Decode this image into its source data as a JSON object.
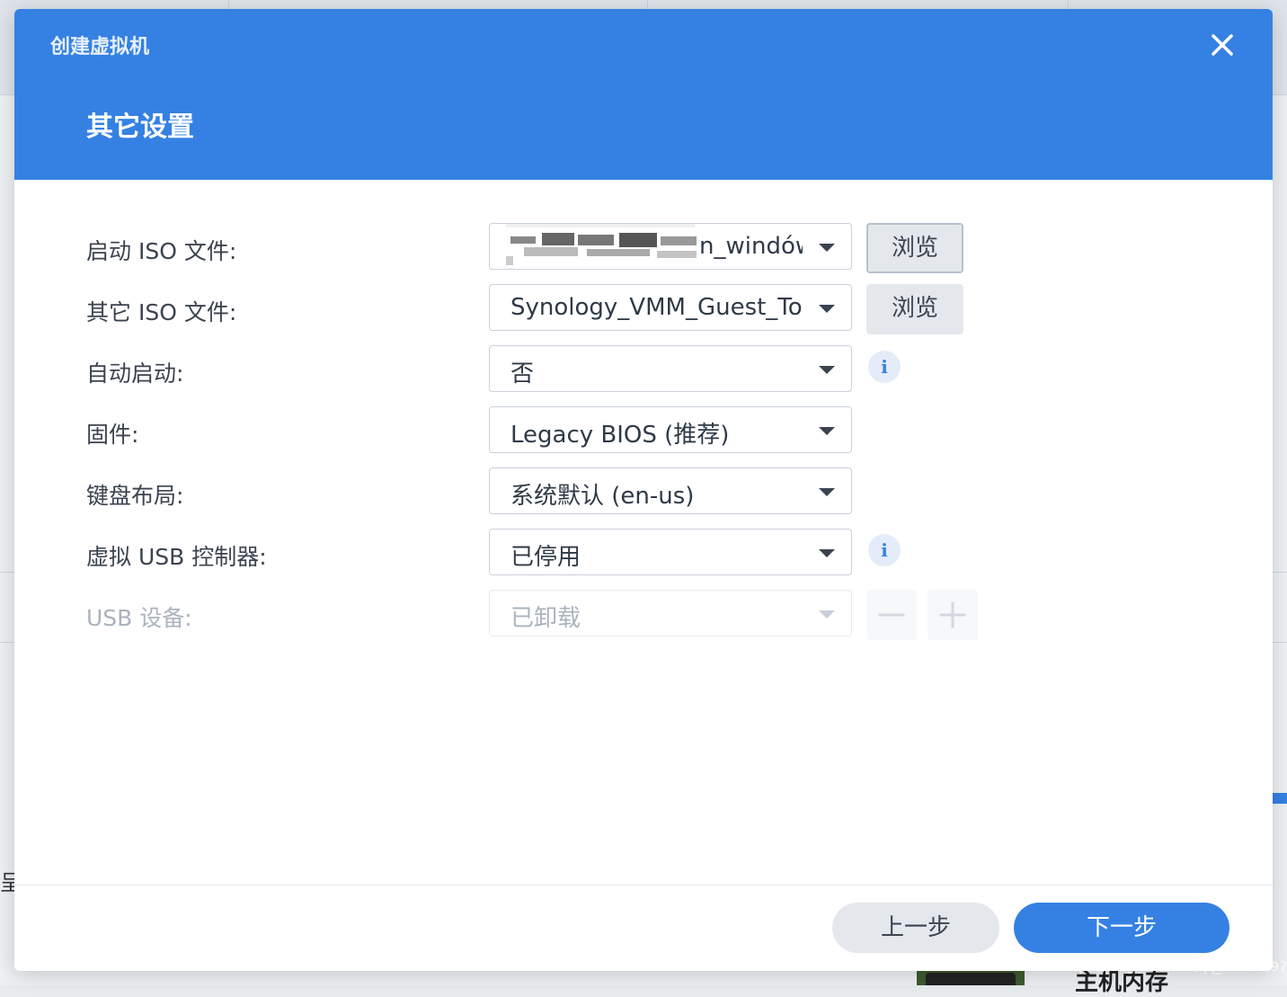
{
  "dialog": {
    "title": "创建虚拟机",
    "step_title": "其它设置",
    "close_icon": "close-icon"
  },
  "form": {
    "boot_iso": {
      "label": "启动 ISO 文件:",
      "value": "n_windów",
      "browse": "浏览",
      "value_obscured": true
    },
    "other_iso": {
      "label": "其它 ISO 文件:",
      "value": "Synology_VMM_Guest_Tool",
      "browse": "浏览"
    },
    "autostart": {
      "label": "自动启动:",
      "value": "否",
      "info_icon": "info-icon"
    },
    "firmware": {
      "label": "固件:",
      "value": "Legacy BIOS (推荐)"
    },
    "keyboard": {
      "label": "键盘布局:",
      "value": "系统默认 (en-us)"
    },
    "usb_controller": {
      "label": "虚拟 USB 控制器:",
      "value": "已停用",
      "info_icon": "info-icon"
    },
    "usb_device": {
      "label": "USB 设备:",
      "value": "已卸载",
      "disabled": true,
      "remove_icon": "minus-icon",
      "add_icon": "plus-icon"
    }
  },
  "footer": {
    "prev": "上一步",
    "next": "下一步"
  },
  "background": {
    "bottom_text": "主机内存",
    "left_char": "呈",
    "watermark": "https://blog.csdn.net/qq_20291097"
  },
  "colors": {
    "accent": "#3581e3",
    "text": "#3b4350",
    "disabled_text": "#aab3be"
  }
}
